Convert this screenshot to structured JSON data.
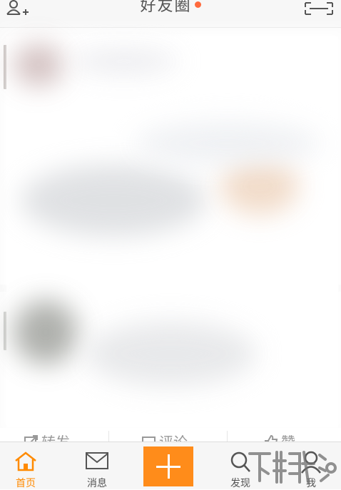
{
  "header": {
    "title": "好友圈",
    "has_notification_dot": true,
    "notification_color": "#ff6a3d"
  },
  "actions": {
    "repost": "转发",
    "comment": "评论",
    "like": "赞"
  },
  "tabbar": {
    "tabs": [
      {
        "id": "home",
        "label": "首页",
        "active": true
      },
      {
        "id": "messages",
        "label": "消息",
        "active": false
      },
      {
        "id": "discover",
        "label": "发现",
        "active": false
      },
      {
        "id": "me",
        "label": "我",
        "active": false
      }
    ],
    "publish_icon": "plus-icon"
  },
  "colors": {
    "accent": "#ff8a00",
    "publish_button": "#ff8c1a"
  }
}
